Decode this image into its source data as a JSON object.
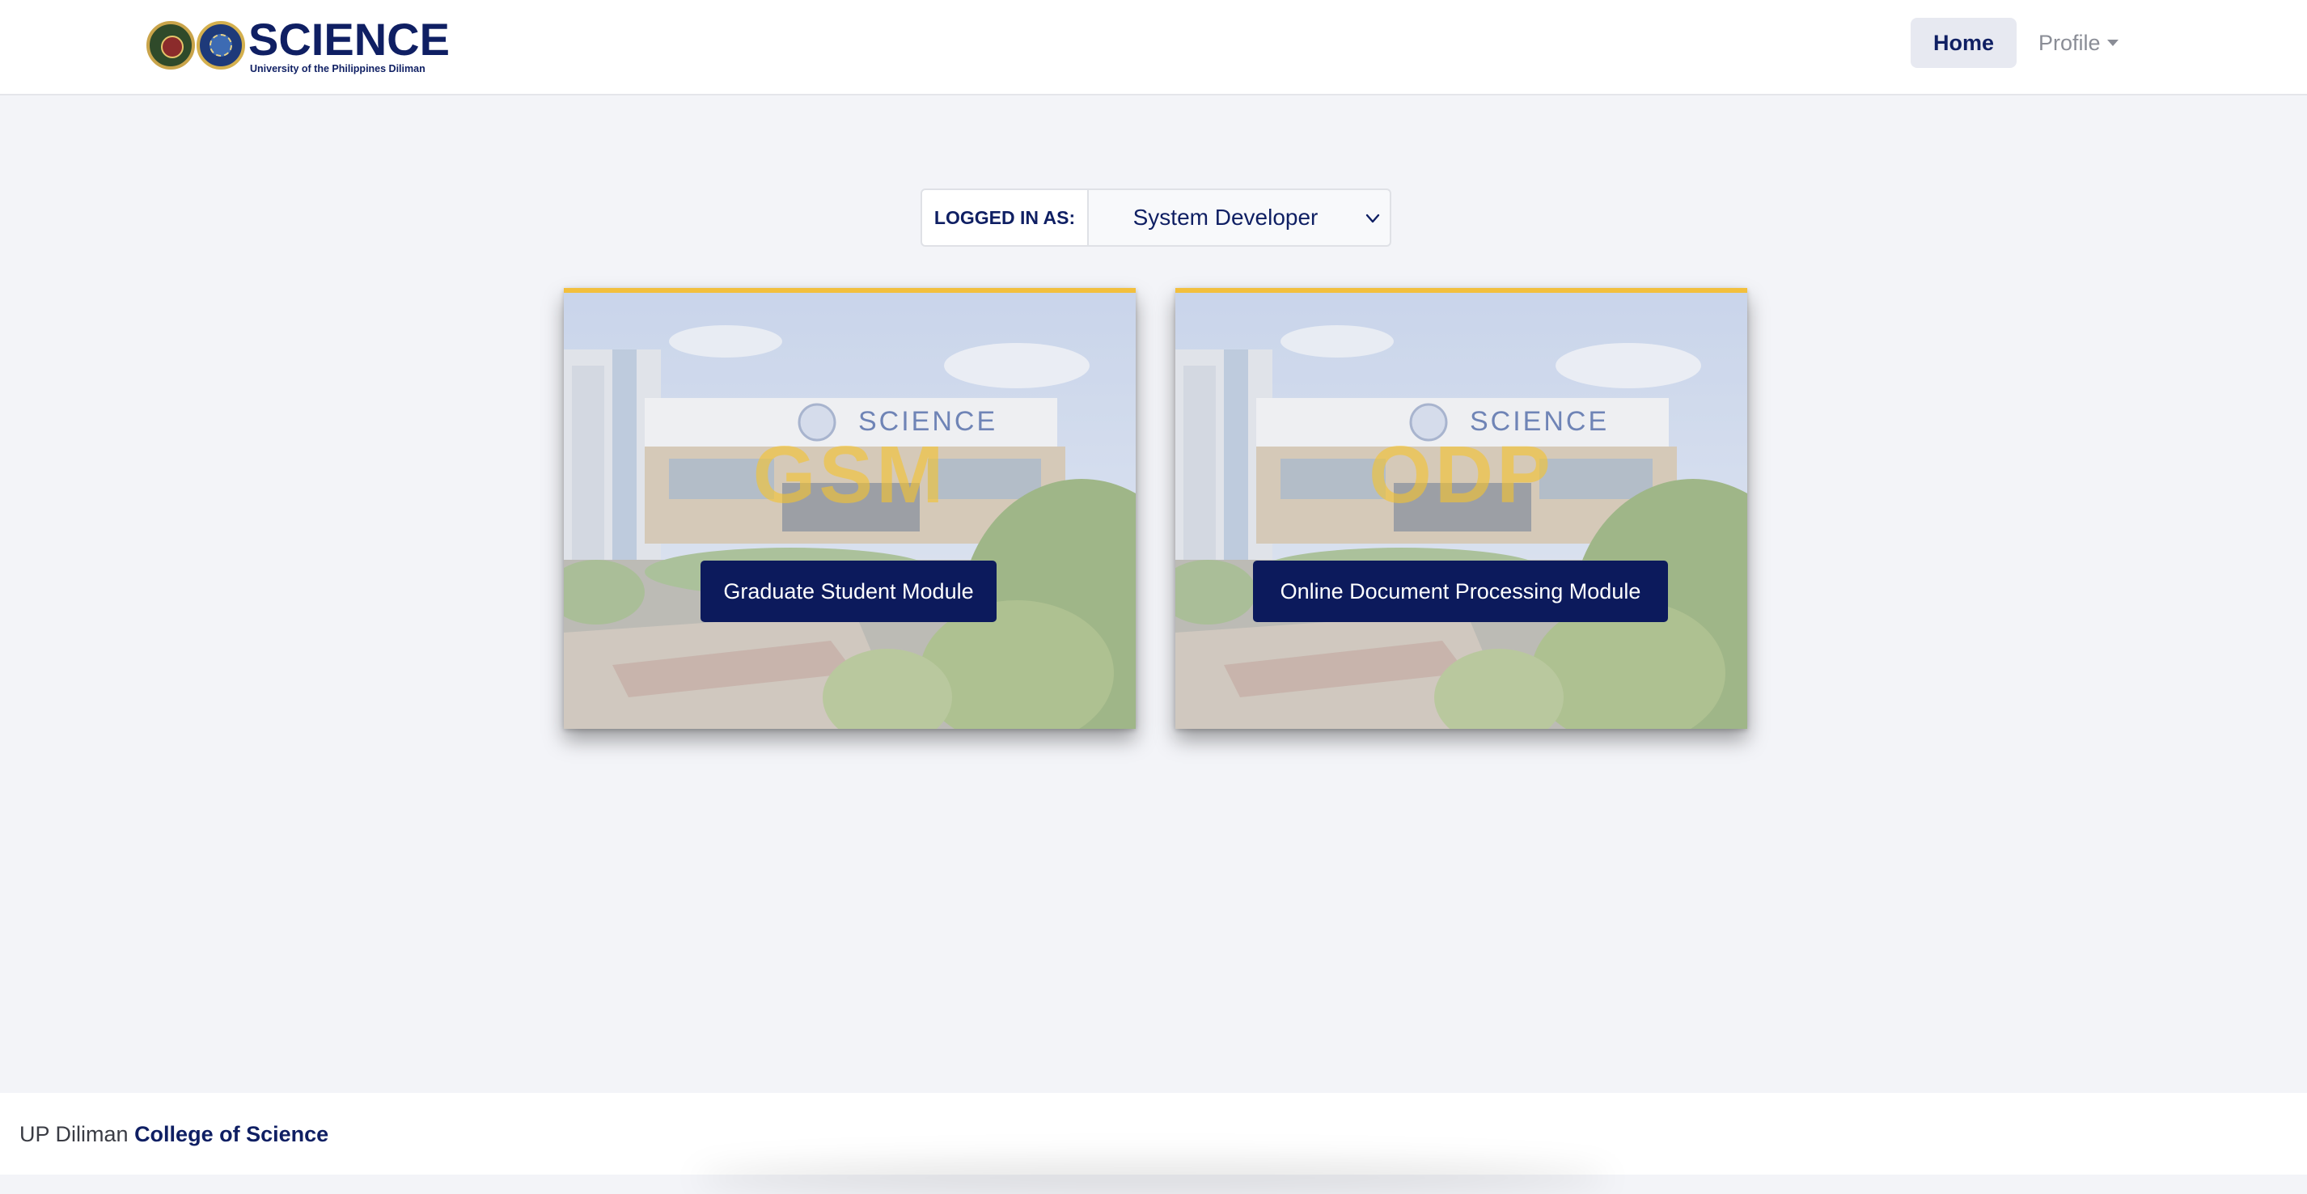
{
  "header": {
    "brand_title": "SCIENCE",
    "brand_subtitle": "University of the Philippines Diliman",
    "nav": {
      "home_label": "Home",
      "profile_label": "Profile"
    }
  },
  "role": {
    "label": "LOGGED IN AS:",
    "selected": "System Developer"
  },
  "modules": [
    {
      "watermark": "GSM",
      "button_label": "Graduate Student Module",
      "building_sign": "SCIENCE"
    },
    {
      "watermark": "ODP",
      "button_label": "Online Document Processing Module",
      "building_sign": "SCIENCE"
    }
  ],
  "footer": {
    "prefix": "UP Diliman",
    "strong": "College of Science"
  },
  "colors": {
    "primary": "#0c1a5c",
    "accent": "#f2bf3d",
    "background": "#f3f4f8"
  }
}
